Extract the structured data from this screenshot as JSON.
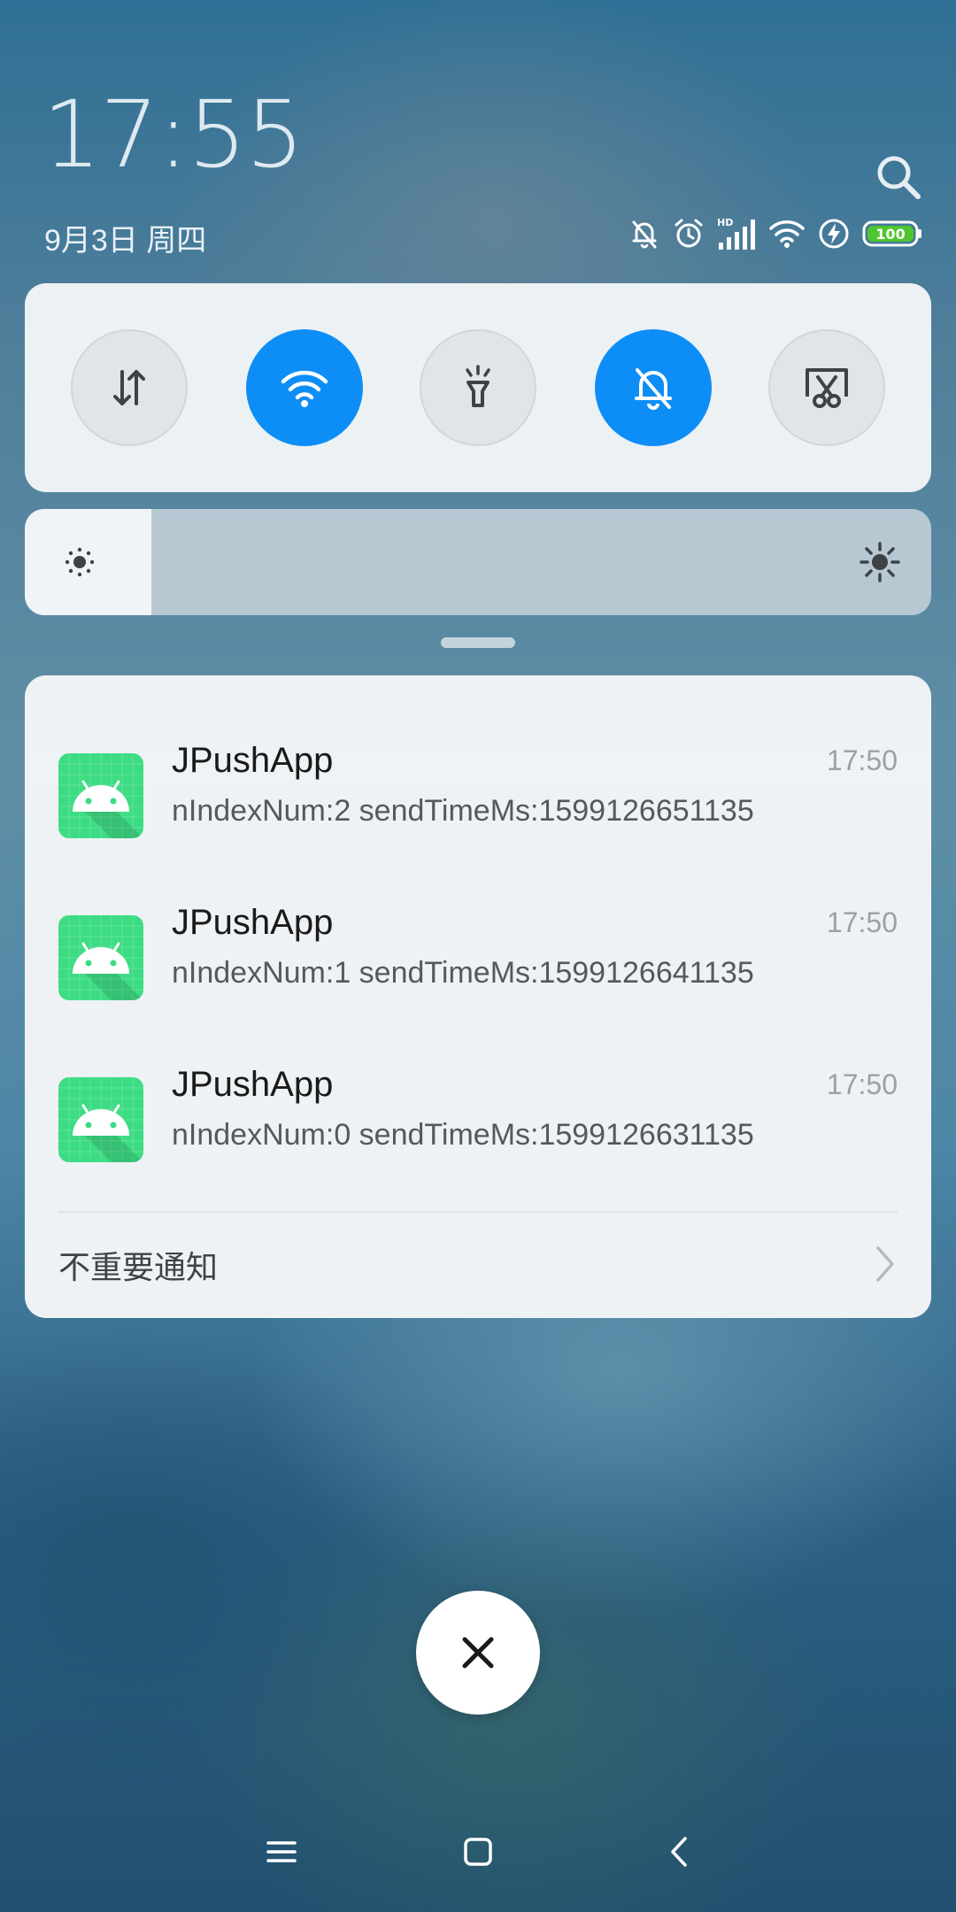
{
  "status_bar": {
    "time": "17:55",
    "date": "9月3日 周四",
    "battery": "100",
    "network_label": "HD"
  },
  "quick_settings": [
    {
      "name": "mobile-data",
      "icon": "data-arrows-icon",
      "active": false
    },
    {
      "name": "wifi",
      "icon": "wifi-icon",
      "active": true
    },
    {
      "name": "flashlight",
      "icon": "flashlight-icon",
      "active": false
    },
    {
      "name": "mute",
      "icon": "bell-off-icon",
      "active": true
    },
    {
      "name": "screenshot",
      "icon": "screenshot-icon",
      "active": false
    }
  ],
  "brightness": {
    "level": 0.14
  },
  "notifications": [
    {
      "app": "JPushApp",
      "time": "17:50",
      "text": "nIndexNum:2 sendTimeMs:1599126651135"
    },
    {
      "app": "JPushApp",
      "time": "17:50",
      "text": "nIndexNum:1 sendTimeMs:1599126641135"
    },
    {
      "app": "JPushApp",
      "time": "17:50",
      "text": "nIndexNum:0 sendTimeMs:1599126631135"
    }
  ],
  "minor_notifications_label": "不重要通知",
  "colors": {
    "accent": "#0d8ef7",
    "app_icon_green": "#3ddc84",
    "battery_green": "#4fc62f"
  }
}
